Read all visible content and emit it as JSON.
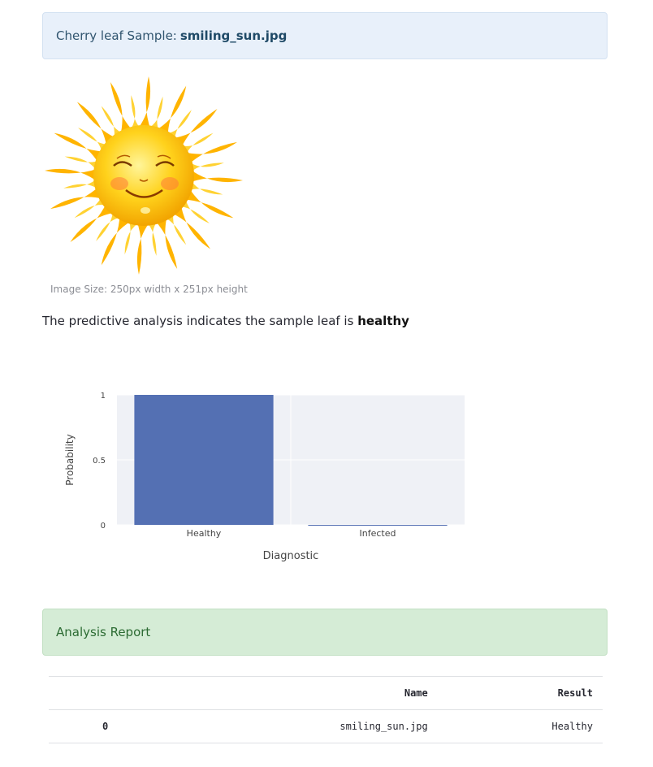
{
  "info": {
    "prefix": "Cherry leaf Sample: ",
    "filename": "smiling_sun.jpg"
  },
  "image": {
    "caption": "Image Size: 250px width x 251px height",
    "icon": "smiling-sun-image"
  },
  "prediction": {
    "text": "The predictive analysis indicates the sample leaf is ",
    "result": "healthy"
  },
  "chart_data": {
    "type": "bar",
    "categories": [
      "Healthy",
      "Infected"
    ],
    "values": [
      1,
      0
    ],
    "xlabel": "Diagnostic",
    "ylabel": "Probability",
    "ylim": [
      0,
      1
    ],
    "yticks": [
      "0",
      "0.5",
      "1"
    ],
    "grid": true,
    "bar_color": "#5470b3",
    "plot_bg": "#eff1f6"
  },
  "report": {
    "title": "Analysis Report",
    "columns": [
      "",
      "Name",
      "Result"
    ],
    "rows": [
      [
        "0",
        "smiling_sun.jpg",
        "Healthy"
      ]
    ]
  }
}
